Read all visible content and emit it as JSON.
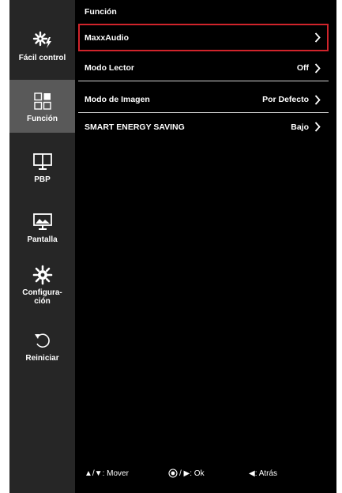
{
  "sidebar": {
    "items": [
      {
        "label": "Fácil control",
        "icon": "easy-control-icon"
      },
      {
        "label": "Función",
        "icon": "function-icon",
        "active": true
      },
      {
        "label": "PBP",
        "icon": "pbp-icon"
      },
      {
        "label": "Pantalla",
        "icon": "screen-icon"
      },
      {
        "label": "Configura-\nción",
        "icon": "settings-icon"
      },
      {
        "label": "Reiniciar",
        "icon": "reset-icon"
      }
    ]
  },
  "main": {
    "title": "Función",
    "rows": [
      {
        "label": "MaxxAudio",
        "value": "",
        "selected": true
      },
      {
        "label": "Modo Lector",
        "value": "Off"
      },
      {
        "label": "Modo de Imagen",
        "value": "Por Defecto"
      },
      {
        "label": "SMART ENERGY SAVING",
        "value": "Bajo"
      }
    ]
  },
  "footer": {
    "move": "▲/▼: Mover",
    "ok_sep": "/ ▶: Ok",
    "back": "◀: Atrás"
  },
  "colors": {
    "background": "#000000",
    "sidebar": "#262626",
    "sidebar_active": "#595959",
    "selection_border": "#d0242b",
    "text": "#ffffff"
  }
}
